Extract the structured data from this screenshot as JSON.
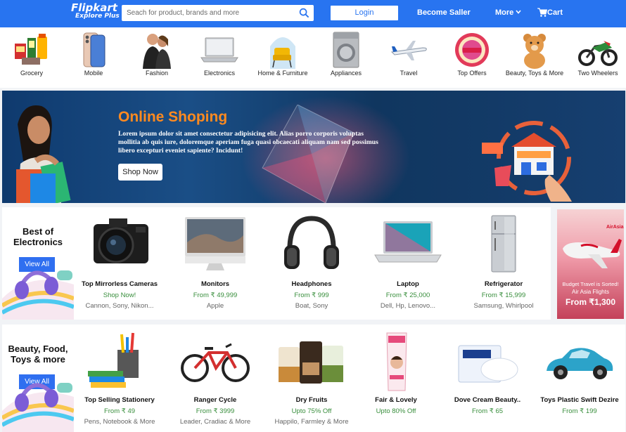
{
  "header": {
    "logo_name": "Flipkart",
    "logo_tag": "Explore Plus",
    "search_placeholder": "Seach for product, brands and more",
    "login_label": "Login",
    "become_seller_label": "Become Saller",
    "more_label": "More",
    "cart_label": "Cart",
    "brand_color": "#2874f0"
  },
  "categories": [
    {
      "label": "Grocery",
      "icon": "grocery-icon"
    },
    {
      "label": "Mobile",
      "icon": "mobile-icon"
    },
    {
      "label": "Fashion",
      "icon": "fashion-icon"
    },
    {
      "label": "Electronics",
      "icon": "electronics-icon"
    },
    {
      "label": "Home & Furniture",
      "icon": "furniture-icon"
    },
    {
      "label": "Appliances",
      "icon": "appliances-icon"
    },
    {
      "label": "Travel",
      "icon": "travel-icon"
    },
    {
      "label": "Top Offers",
      "icon": "offers-icon"
    },
    {
      "label": "Beauty, Toys & More",
      "icon": "toys-icon"
    },
    {
      "label": "Two Wheelers",
      "icon": "two-wheelers-icon"
    }
  ],
  "banner": {
    "title": "Online Shoping",
    "text": "Lorem ipsum dolor sit amet consectetur adipisicing elit. Alias porro corporis voluptas mollitia ab quis iure, doloremque aperiam fuga quasi obcaecati aliquam nam sed possimus libero excepturi eveniet sapiente? Incidunt!",
    "button_label": "Shop Now",
    "title_color": "#ff8a1f"
  },
  "electronics": {
    "title": "Best of Electronics",
    "view_all_label": "View All",
    "products": [
      {
        "name": "Top Mirrorless Cameras",
        "price": "Shop Now!",
        "brands": "Cannon, Sony, Nikon...",
        "icon": "camera-icon"
      },
      {
        "name": "Monitors",
        "price": "From ₹ 49,999",
        "brands": "Apple",
        "icon": "monitor-icon"
      },
      {
        "name": "Headphones",
        "price": "From ₹ 999",
        "brands": "Boat, Sony",
        "icon": "headphones-icon"
      },
      {
        "name": "Laptop",
        "price": "From ₹ 25,000",
        "brands": "Dell, Hp, Lenovo...",
        "icon": "laptop-icon"
      },
      {
        "name": "Refrigerator",
        "price": "From ₹ 15,999",
        "brands": "Samsung, Whirlpool",
        "icon": "refrigerator-icon"
      }
    ]
  },
  "ad": {
    "brand": "AirAsia",
    "line1": "Budget Travel is Sorted!",
    "line2": "Air Asia Flights",
    "line3": "From ₹1,300"
  },
  "beauty": {
    "title": "Beauty, Food, Toys & more",
    "view_all_label": "View All",
    "products": [
      {
        "name": "Top Selling Stationery",
        "price": "From ₹ 49",
        "brands": "Pens, Notebook & More",
        "icon": "stationery-icon"
      },
      {
        "name": "Ranger Cycle",
        "price": "From ₹ 3999",
        "brands": "Leader, Cradiac & More",
        "icon": "cycle-icon"
      },
      {
        "name": "Dry Fruits",
        "price": "Upto 75% Off",
        "brands": "Happilo, Farmley & More",
        "icon": "dry-fruits-icon"
      },
      {
        "name": "Fair & Lovely",
        "price": "Upto 80% Off",
        "brands": "",
        "icon": "cream-tube-icon"
      },
      {
        "name": "Dove Cream Beauty..",
        "price": "From ₹ 65",
        "brands": "",
        "icon": "soap-icon"
      },
      {
        "name": "Toys Plastic Swift Dezire",
        "price": "From ₹ 199",
        "brands": "",
        "icon": "toy-car-icon"
      }
    ]
  }
}
